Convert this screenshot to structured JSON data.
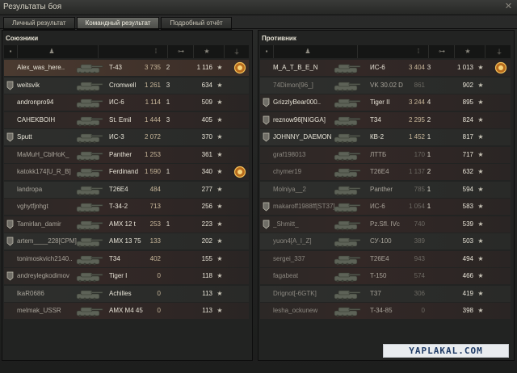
{
  "window": {
    "title": "Результаты боя"
  },
  "tabs": [
    {
      "label": "Личный результат",
      "active": false
    },
    {
      "label": "Командный результат",
      "active": true
    },
    {
      "label": "Подробный отчёт",
      "active": false
    }
  ],
  "allies": {
    "title": "Союзники",
    "rows": [
      {
        "name": "Alex_was_here..",
        "tank": "T-43",
        "damage": "3 735",
        "kills": "2",
        "xp": "1 116",
        "medal": true,
        "badge": false,
        "dead": false,
        "self": true
      },
      {
        "name": "weitsvik",
        "tank": "Cromwell",
        "damage": "1 261",
        "kills": "3",
        "xp": "634",
        "medal": false,
        "badge": true,
        "dead": false
      },
      {
        "name": "andronpro94",
        "tank": "ИС-6",
        "damage": "1 114",
        "kills": "1",
        "xp": "509",
        "medal": false,
        "badge": false,
        "dead": false
      },
      {
        "name": "CAHEKBOIH",
        "tank": "St. Emil",
        "damage": "1 444",
        "kills": "3",
        "xp": "405",
        "medal": false,
        "badge": false,
        "dead": false
      },
      {
        "name": "Sputt",
        "tank": "ИС-3",
        "damage": "2 072",
        "kills": "",
        "xp": "370",
        "medal": false,
        "badge": true,
        "dead": false
      },
      {
        "name": "MaMuH_CblHoK_",
        "tank": "Panther",
        "damage": "1 253",
        "kills": "",
        "xp": "361",
        "medal": false,
        "badge": false,
        "dead": false
      },
      {
        "name": "katokk174[U_R_B]",
        "tank": "Ferdinand",
        "damage": "1 590",
        "kills": "1",
        "xp": "340",
        "medal": true,
        "badge": false,
        "dead": false
      },
      {
        "name": "landropa",
        "tank": "T26E4",
        "damage": "484",
        "kills": "",
        "xp": "277",
        "medal": false,
        "badge": false,
        "dead": false
      },
      {
        "name": "vghytfjnhgt",
        "tank": "T-34-2",
        "damage": "713",
        "kills": "",
        "xp": "256",
        "medal": false,
        "badge": false,
        "dead": false
      },
      {
        "name": "Tamirlan_damir",
        "tank": "AMX 12 t",
        "damage": "253",
        "kills": "1",
        "xp": "223",
        "medal": false,
        "badge": true,
        "dead": false
      },
      {
        "name": "artem____228[CPM]",
        "tank": "AMX 13 75",
        "damage": "133",
        "kills": "",
        "xp": "202",
        "medal": false,
        "badge": true,
        "dead": false
      },
      {
        "name": "tonimoskvich2140..",
        "tank": "T34",
        "damage": "402",
        "kills": "",
        "xp": "155",
        "medal": false,
        "badge": false,
        "dead": false
      },
      {
        "name": "andreylegkodimov",
        "tank": "Tiger I",
        "damage": "0",
        "kills": "",
        "xp": "118",
        "medal": false,
        "badge": true,
        "dead": false
      },
      {
        "name": "lkaR0686",
        "tank": "Achilles",
        "damage": "0",
        "kills": "",
        "xp": "113",
        "medal": false,
        "badge": false,
        "dead": false
      },
      {
        "name": "melmak_USSR",
        "tank": "AMX M4 45",
        "damage": "0",
        "kills": "",
        "xp": "113",
        "medal": false,
        "badge": false,
        "dead": false
      }
    ]
  },
  "enemies": {
    "title": "Противник",
    "rows": [
      {
        "name": "M_A_T_B_E_N",
        "tank": "ИС-6",
        "damage": "3 404",
        "kills": "3",
        "xp": "1 013",
        "medal": true,
        "badge": false,
        "dead": false
      },
      {
        "name": "74Dimon[96_]",
        "tank": "VK 30.02 D",
        "damage": "861",
        "kills": "",
        "xp": "902",
        "medal": false,
        "badge": false,
        "dead": true
      },
      {
        "name": "GrizzlyBear000..",
        "tank": "Tiger II",
        "damage": "3 244",
        "kills": "4",
        "xp": "895",
        "medal": false,
        "badge": true,
        "dead": false
      },
      {
        "name": "reznow96[NIGGA]",
        "tank": "T34",
        "damage": "2 295",
        "kills": "2",
        "xp": "824",
        "medal": false,
        "badge": true,
        "dead": false
      },
      {
        "name": "JOHNNY_DAEMON",
        "tank": "КВ-2",
        "damage": "1 452",
        "kills": "1",
        "xp": "817",
        "medal": false,
        "badge": true,
        "dead": false
      },
      {
        "name": "graf198013",
        "tank": "ЛТТБ",
        "damage": "170",
        "kills": "1",
        "xp": "717",
        "medal": false,
        "badge": false,
        "dead": true
      },
      {
        "name": "chymer19",
        "tank": "T26E4",
        "damage": "1 137",
        "kills": "2",
        "xp": "632",
        "medal": false,
        "badge": false,
        "dead": true
      },
      {
        "name": "Molniya__2",
        "tank": "Panther",
        "damage": "785",
        "kills": "1",
        "xp": "594",
        "medal": false,
        "badge": false,
        "dead": true
      },
      {
        "name": "makaroff1988ff[ST37]",
        "tank": "ИС-6",
        "damage": "1 054",
        "kills": "1",
        "xp": "583",
        "medal": false,
        "badge": true,
        "dead": true
      },
      {
        "name": "_Shmitt_",
        "tank": "Pz.Sfl. IVc",
        "damage": "740",
        "kills": "",
        "xp": "539",
        "medal": false,
        "badge": true,
        "dead": true
      },
      {
        "name": "yuon4[A_I_Z]",
        "tank": "СУ-100",
        "damage": "389",
        "kills": "",
        "xp": "503",
        "medal": false,
        "badge": false,
        "dead": true
      },
      {
        "name": "sergei_337",
        "tank": "T26E4",
        "damage": "943",
        "kills": "",
        "xp": "494",
        "medal": false,
        "badge": false,
        "dead": true
      },
      {
        "name": "fagabeat",
        "tank": "T-150",
        "damage": "574",
        "kills": "",
        "xp": "466",
        "medal": false,
        "badge": false,
        "dead": true
      },
      {
        "name": "Drignot[-6GTK]",
        "tank": "T37",
        "damage": "306",
        "kills": "",
        "xp": "419",
        "medal": false,
        "badge": false,
        "dead": true
      },
      {
        "name": "lesha_ockunew",
        "tank": "T-34-85",
        "damage": "0",
        "kills": "",
        "xp": "398",
        "medal": false,
        "badge": false,
        "dead": true
      }
    ]
  },
  "watermark": "YAPLAKAL.COM",
  "colors": {
    "accent": "#e9e5d8",
    "row_red": "#332826",
    "row_grey": "#2e2f2d",
    "watermark_text": "#1f3b66"
  }
}
